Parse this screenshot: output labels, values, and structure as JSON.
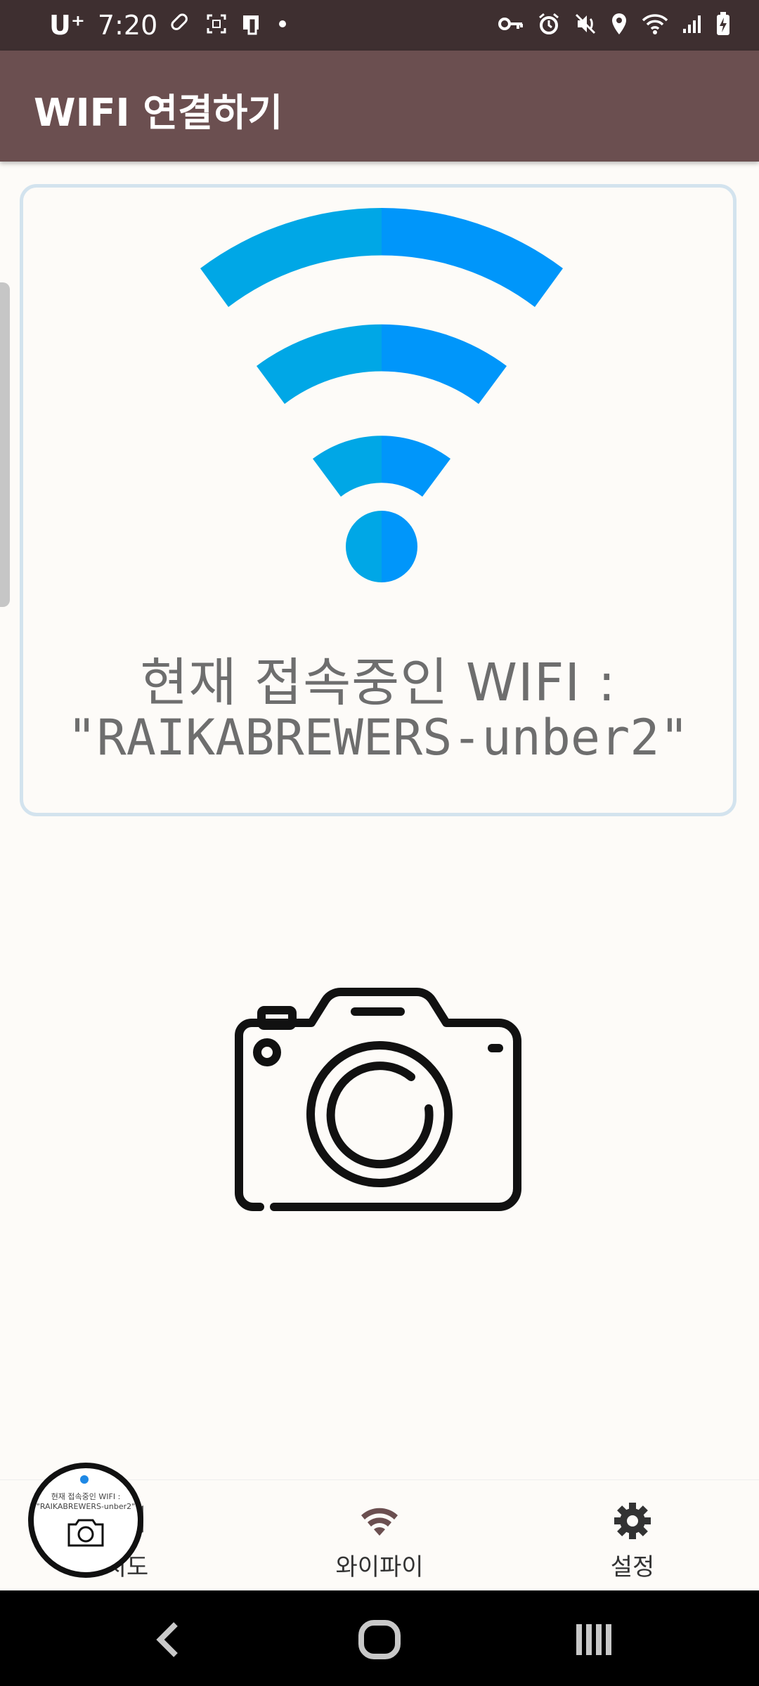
{
  "status_bar": {
    "carrier": "U⁺",
    "time": "7:20",
    "left_icons": [
      "link-icon",
      "screenshot-icon",
      "notification-app-icon",
      "dot-icon"
    ],
    "right_icons": [
      "vpn-key-icon",
      "alarm-icon",
      "mute-icon",
      "location-icon",
      "wifi-signal-icon",
      "cell-signal-icon",
      "battery-charging-icon"
    ]
  },
  "app_bar": {
    "title": "WIFI 연결하기"
  },
  "wifi_card": {
    "label": "현재 접속중인 WIFI :",
    "ssid": "\"RAIKABREWERS-unber2\""
  },
  "camera": {
    "icon": "camera-icon"
  },
  "bottom_nav": {
    "items": [
      {
        "label": "지도",
        "icon": "map-icon"
      },
      {
        "label": "와이파이",
        "icon": "wifi-icon"
      },
      {
        "label": "설정",
        "icon": "gear-icon"
      }
    ]
  },
  "bubble": {
    "line1": "현재 접속중인 WIFI :",
    "line2": "\"RAIKABREWERS-unber2\""
  },
  "colors": {
    "status_bar_bg": "#3e2f30",
    "app_bar_bg": "#6b4f50",
    "wifi_light": "#00a7e6",
    "wifi_dark": "#0096fa",
    "card_border": "#d3e3ee",
    "wifi_nav_icon": "#6b4f50",
    "settings_icon": "#333333"
  }
}
